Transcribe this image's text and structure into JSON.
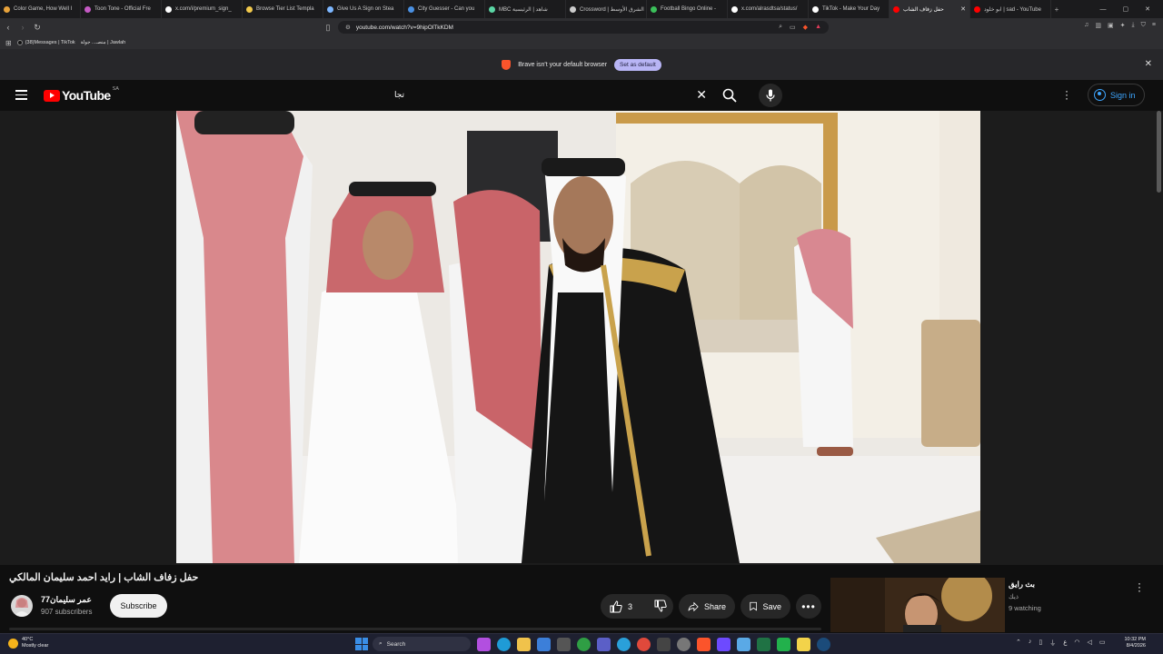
{
  "browser": {
    "tabs": [
      {
        "label": "Color Game, How Well I",
        "color": "#e8a33b"
      },
      {
        "label": "Toon Tone - Official Fre",
        "color": "#c55ac5"
      },
      {
        "label": "x.com/i/premium_sign_",
        "color": "#ffffff"
      },
      {
        "label": "Browse Tier List Templa",
        "color": "#f2c94c"
      },
      {
        "label": "Give Us A Sign on Stea",
        "color": "#7db7ff"
      },
      {
        "label": "City Guesser - Can you",
        "color": "#4a90e2"
      },
      {
        "label": "MBC شاهد | الرئيسية",
        "color": "#5bd6a5"
      },
      {
        "label": "Crossword | الشرق الأوسط",
        "color": "#cccccc"
      },
      {
        "label": "Football Bingo Online -",
        "color": "#3bbf5a"
      },
      {
        "label": "x.com/alrasdtsa/status/",
        "color": "#ffffff"
      },
      {
        "label": "TikTok - Make Your Day",
        "color": "#ffffff"
      },
      {
        "label": "حفل زفاف الشاب",
        "color": "#ff0000",
        "active": true
      },
      {
        "label": "ابو خلود | sad - YouTube",
        "color": "#ff0000"
      }
    ],
    "url": "youtube.com/watch?v=9hipOlTkKDM",
    "bookmarks": [
      {
        "label": "(38)Messages | TikTok"
      },
      {
        "label": "منصـ... جولة | Jawlah"
      }
    ],
    "infobar": {
      "message": "Brave isn't your default browser",
      "button": "Set as default"
    }
  },
  "youtube": {
    "logo": "YouTube",
    "country_code": "SA",
    "search_value": "تجا",
    "signin": "Sign in"
  },
  "video": {
    "title": "حفل زفاف الشاب | رايد احمد سليمان المالكي",
    "channel": "عمر سليمان77",
    "subscribers": "907 subscribers",
    "subscribe_label": "Subscribe",
    "likes": "3",
    "share_label": "Share",
    "save_label": "Save"
  },
  "recommended": {
    "title": "بث رايق",
    "subtitle": "ذيك",
    "watching": "9 watching"
  },
  "taskbar": {
    "temperature": "40°C",
    "condition": "Mostly clear",
    "search_label": "Search",
    "time": "10:32 PM",
    "date": "8/4/2026"
  }
}
